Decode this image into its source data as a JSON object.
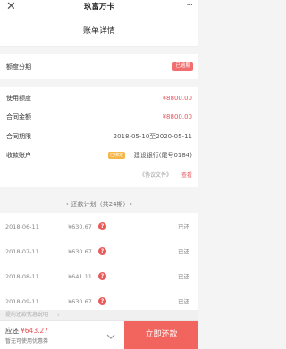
{
  "titlebar": {
    "title": "玖富万卡",
    "close_glyph": "✕",
    "more_glyph": "···"
  },
  "page": {
    "title": "账单详情"
  },
  "info": {
    "rows": [
      {
        "label": "额度分期",
        "badge": "已逾期"
      },
      {
        "label": "使用额度",
        "value": "¥8800.00"
      },
      {
        "label": "合同金额",
        "value": "¥8800.00"
      },
      {
        "label": "合同期限",
        "value": "2018-05-10至2020-05-11"
      },
      {
        "label": "收款账户",
        "badge": "已绑定",
        "value": "建设银行(尾号0184)"
      }
    ],
    "agreement_link": "《协议文件》",
    "agreement_action": "查看"
  },
  "plan": {
    "title": "• 还款计划（共24期）•",
    "rows": [
      {
        "date": "2018-06-11",
        "amount": "¥630.67",
        "status": "已还"
      },
      {
        "date": "2018-07-11",
        "amount": "¥630.67",
        "status": "已还"
      },
      {
        "date": "2018-08-11",
        "amount": "¥641.11",
        "status": "已还"
      },
      {
        "date": "2018-09-11",
        "amount": "¥630.67",
        "status": "已还"
      }
    ]
  },
  "coupon_bar": {
    "text": "提前还款优惠说明",
    "chevron": "›"
  },
  "footer": {
    "due_label": "应还",
    "due_amount": "¥643.27",
    "coupon_text": "暂无可使用优惠券",
    "pay_button": "立即还款"
  },
  "colors": {
    "accent": "#f2645e",
    "red_text": "#e8545a",
    "overdue_badge": "#f26d6d",
    "bank_badge": "#f5b547"
  }
}
